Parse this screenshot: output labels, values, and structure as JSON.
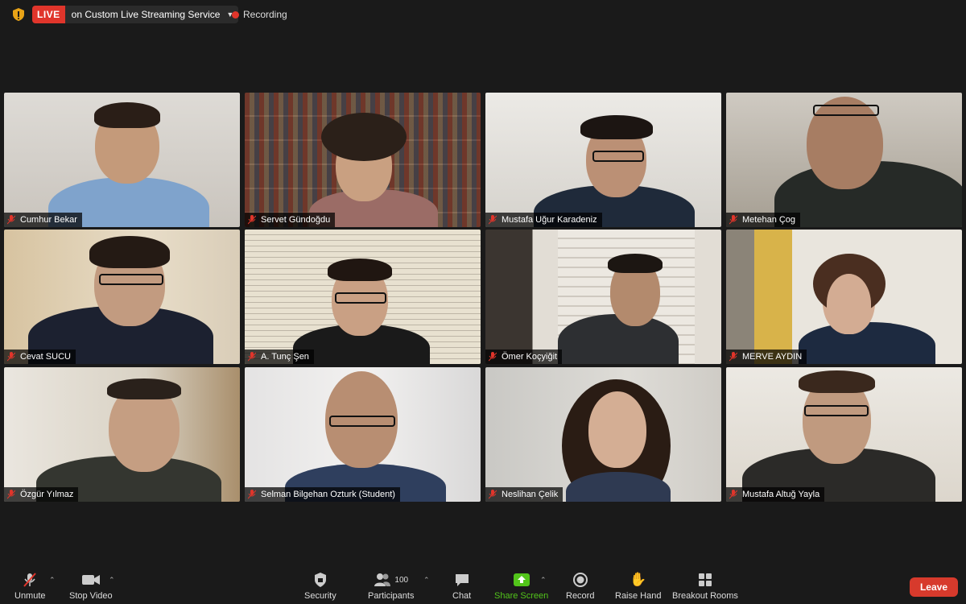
{
  "topbar": {
    "live_label": "LIVE",
    "stream_label": "on Custom Live Streaming Service",
    "recording_label": "Recording"
  },
  "participants": [
    {
      "name": "Cumhur Bekar"
    },
    {
      "name": "Servet Gündoğdu"
    },
    {
      "name": "Mustafa Uğur Karadeniz"
    },
    {
      "name": "Metehan Çog"
    },
    {
      "name": "Cevat SUCU"
    },
    {
      "name": "A. Tunç Şen"
    },
    {
      "name": "Ömer Koçyiğit"
    },
    {
      "name": "MERVE AYDIN"
    },
    {
      "name": "Özgür Yılmaz"
    },
    {
      "name": "Selman Bilgehan Ozturk (Student)"
    },
    {
      "name": "Neslihan Çelik"
    },
    {
      "name": "Mustafa Altuğ Yayla"
    }
  ],
  "toolbar": {
    "unmute": "Unmute",
    "stop_video": "Stop Video",
    "security": "Security",
    "participants": "Participants",
    "participant_count": "100",
    "chat": "Chat",
    "share_screen": "Share Screen",
    "record": "Record",
    "raise_hand": "Raise Hand",
    "breakout_rooms": "Breakout Rooms",
    "leave": "Leave"
  },
  "colors": {
    "accent_live": "#e0352b",
    "active_speaker": "#d7e04a",
    "share_green": "#52c41a",
    "leave_red": "#d73a2c"
  }
}
